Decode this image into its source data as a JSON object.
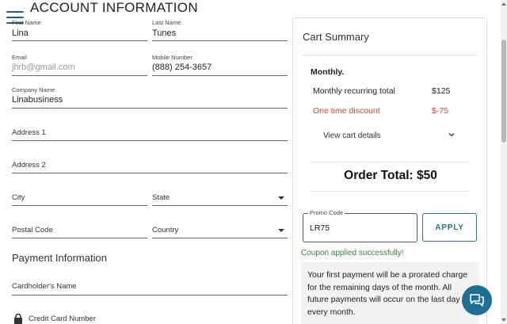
{
  "header": {
    "title": "ACCOUNT INFORMATION",
    "menu_icon": "hamburger-icon"
  },
  "form": {
    "first_name": {
      "label": "First Name",
      "value": "Lina"
    },
    "last_name": {
      "label": "Last Name",
      "value": "Tunes"
    },
    "email": {
      "label": "Email",
      "value": "",
      "placeholder": "jhrb@gmail.com"
    },
    "mobile": {
      "label": "Mobile Number",
      "value": "(888) 254-3657"
    },
    "company": {
      "label": "Company Name",
      "value": "Linabusiness"
    },
    "address1": {
      "label": "Address 1"
    },
    "address2": {
      "label": "Address 2"
    },
    "city": {
      "label": "City"
    },
    "state": {
      "label": "State"
    },
    "postal": {
      "label": "Postal Code"
    },
    "country": {
      "label": "Country"
    }
  },
  "payment": {
    "heading": "Payment Information",
    "cardholder": {
      "label": "Cardholder's Name"
    },
    "card_number": {
      "label": "Credit Card Number",
      "icon": "lock-icon"
    }
  },
  "summary": {
    "title": "Cart Summary",
    "plan": "Monthly.",
    "rows": [
      {
        "label": "Monthly recurring total",
        "value": "$125",
        "color": "#222222"
      },
      {
        "label": "One time discount",
        "value": "$-75",
        "color": "#d9432f"
      }
    ],
    "view_details": "View cart details",
    "total": "Order Total: $50",
    "promo": {
      "label": "Promo Code",
      "value": "LR75"
    },
    "apply_label": "APPLY",
    "coupon_message": "Coupon applied successfully!",
    "note": "Your first payment will be a prorated charge for the remaining days of the month. All future payments will occur on the last day of every month."
  },
  "colors": {
    "accent": "#2a6f93",
    "success": "#2e8b3a",
    "discount": "#d9432f"
  },
  "chat_icon": "chat-bubble-icon"
}
